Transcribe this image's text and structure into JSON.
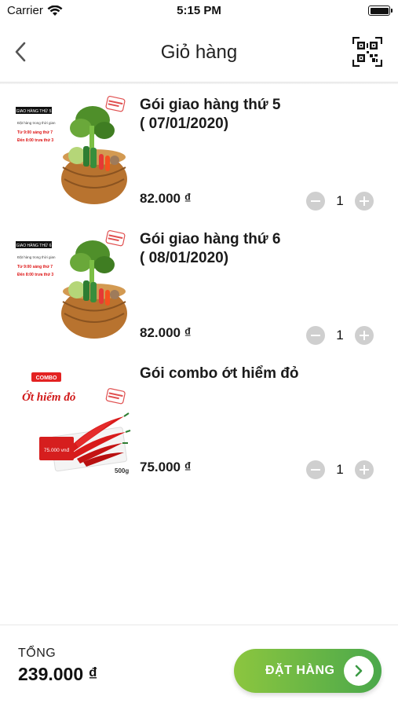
{
  "status_bar": {
    "carrier": "Carrier",
    "time": "5:15 PM"
  },
  "nav": {
    "title": "Giỏ hàng",
    "back_icon": "chevron-left-icon",
    "qr_icon": "qr-code-icon"
  },
  "cart": {
    "items": [
      {
        "name": "Gói giao hàng thứ 5\n( 07/01/2020)",
        "price": "82.000 ₫",
        "quantity": "1",
        "thumb": {
          "type": "basket",
          "tag": "GIAO HÀNG THỨ 5",
          "line1": "Đặt hàng trong thời gian",
          "line2": "Từ 9:00 sáng thứ 7",
          "line3": "Đến 8:00 trưa thứ 3"
        }
      },
      {
        "name": "Gói giao hàng thứ 6\n( 08/01/2020)",
        "price": "82.000 ₫",
        "quantity": "1",
        "thumb": {
          "type": "basket",
          "tag": "GIAO HÀNG THỨ 6",
          "line1": "Đặt hàng trong thời gian",
          "line2": "Từ 9:00 sáng thứ 7",
          "line3": "Đến 8:00 trưa thứ 3"
        }
      },
      {
        "name": "Gói combo ớt hiểm đỏ",
        "price": "75.000 ₫",
        "quantity": "1",
        "thumb": {
          "type": "chili",
          "tag": "COMBO",
          "title": "Ớt hiểm đỏ",
          "price_tag": "75.000 vnđ",
          "weight": "500g"
        }
      }
    ]
  },
  "footer": {
    "total_label": "TỔNG",
    "total_value": "239.000 ₫",
    "order_label": "ĐẶT HÀNG",
    "order_icon": "chevron-right-icon"
  },
  "colors": {
    "accent_start": "#8cc63f",
    "accent_end": "#4aa84b",
    "stepper": "#cfcfcf"
  }
}
